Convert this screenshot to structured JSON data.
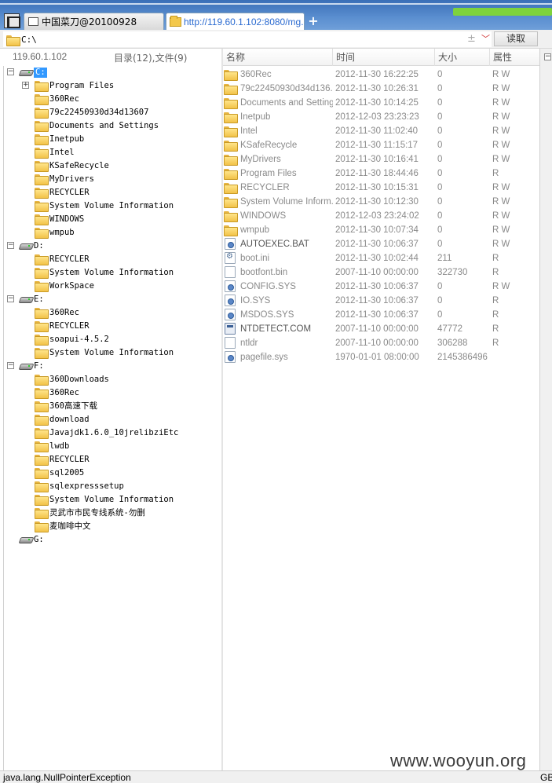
{
  "tabs": [
    {
      "label": "中国菜刀@20100928"
    },
    {
      "label": "http://119.60.1.102:8080/mg..."
    }
  ],
  "new_tab_label": "+",
  "address": {
    "path": "C:\\",
    "plus_label": "±",
    "read_button_label": "读取"
  },
  "left_header": {
    "host": "119.60.1.102",
    "summary": "目录(12),文件(9)"
  },
  "tree": [
    {
      "label": "C:",
      "type": "drive",
      "expander": "−",
      "selected": true
    },
    {
      "label": "Program Files",
      "type": "folder",
      "expander": "+"
    },
    {
      "label": "360Rec",
      "type": "folder"
    },
    {
      "label": "79c22450930d34d13607",
      "type": "folder"
    },
    {
      "label": "Documents and Settings",
      "type": "folder"
    },
    {
      "label": "Inetpub",
      "type": "folder"
    },
    {
      "label": "Intel",
      "type": "folder"
    },
    {
      "label": "KSafeRecycle",
      "type": "folder"
    },
    {
      "label": "MyDrivers",
      "type": "folder"
    },
    {
      "label": "RECYCLER",
      "type": "folder"
    },
    {
      "label": "System Volume Information",
      "type": "folder"
    },
    {
      "label": "WINDOWS",
      "type": "folder"
    },
    {
      "label": "wmpub",
      "type": "folder"
    },
    {
      "label": "D:",
      "type": "drive",
      "expander": "−"
    },
    {
      "label": "RECYCLER",
      "type": "folder"
    },
    {
      "label": "System Volume Information",
      "type": "folder"
    },
    {
      "label": "WorkSpace",
      "type": "folder"
    },
    {
      "label": "E:",
      "type": "drive",
      "expander": "−"
    },
    {
      "label": "360Rec",
      "type": "folder"
    },
    {
      "label": "RECYCLER",
      "type": "folder"
    },
    {
      "label": "soapui-4.5.2",
      "type": "folder"
    },
    {
      "label": "System Volume Information",
      "type": "folder"
    },
    {
      "label": "F:",
      "type": "drive",
      "expander": "−"
    },
    {
      "label": "360Downloads",
      "type": "folder"
    },
    {
      "label": "360Rec",
      "type": "folder"
    },
    {
      "label": "360高速下载",
      "type": "folder"
    },
    {
      "label": "download",
      "type": "folder"
    },
    {
      "label": "Javajdk1.6.0_10jrelibziEtc",
      "type": "folder"
    },
    {
      "label": "lwdb",
      "type": "folder"
    },
    {
      "label": "RECYCLER",
      "type": "folder"
    },
    {
      "label": "sql2005",
      "type": "folder"
    },
    {
      "label": "sqlexpresssetup",
      "type": "folder"
    },
    {
      "label": "System Volume Information",
      "type": "folder"
    },
    {
      "label": "灵武市市民专线系统-勿删",
      "type": "folder"
    },
    {
      "label": "麦咖啡中文",
      "type": "folder"
    },
    {
      "label": "G:",
      "type": "drive"
    }
  ],
  "columns": {
    "name": "名称",
    "time": "时间",
    "size": "大小",
    "attr": "属性"
  },
  "files": [
    {
      "name": "360Rec",
      "time": "2012-11-30 16:22:25",
      "size": "0",
      "attr": "R W",
      "icon": "folder"
    },
    {
      "name": "79c22450930d34d136...",
      "time": "2012-11-30 10:26:31",
      "size": "0",
      "attr": "R W",
      "icon": "folder"
    },
    {
      "name": "Documents and Settings",
      "time": "2012-11-30 10:14:25",
      "size": "0",
      "attr": "R W",
      "icon": "folder"
    },
    {
      "name": "Inetpub",
      "time": "2012-12-03 23:23:23",
      "size": "0",
      "attr": "R W",
      "icon": "folder"
    },
    {
      "name": "Intel",
      "time": "2012-11-30 11:02:40",
      "size": "0",
      "attr": "R W",
      "icon": "folder"
    },
    {
      "name": "KSafeRecycle",
      "time": "2012-11-30 11:15:17",
      "size": "0",
      "attr": "R W",
      "icon": "folder"
    },
    {
      "name": "MyDrivers",
      "time": "2012-11-30 10:16:41",
      "size": "0",
      "attr": "R W",
      "icon": "folder"
    },
    {
      "name": "Program Files",
      "time": "2012-11-30 18:44:46",
      "size": "0",
      "attr": "R",
      "icon": "folder"
    },
    {
      "name": "RECYCLER",
      "time": "2012-11-30 10:15:31",
      "size": "0",
      "attr": "R W",
      "icon": "folder"
    },
    {
      "name": "System Volume Inform...",
      "time": "2012-11-30 10:12:30",
      "size": "0",
      "attr": "R W",
      "icon": "folder"
    },
    {
      "name": "WINDOWS",
      "time": "2012-12-03 23:24:02",
      "size": "0",
      "attr": "R W",
      "icon": "folder"
    },
    {
      "name": "wmpub",
      "time": "2012-11-30 10:07:34",
      "size": "0",
      "attr": "R W",
      "icon": "folder"
    },
    {
      "name": "AUTOEXEC.BAT",
      "time": "2012-11-30 10:06:37",
      "size": "0",
      "attr": "R W",
      "icon": "sys",
      "dark": true
    },
    {
      "name": "boot.ini",
      "time": "2012-11-30 10:02:44",
      "size": "211",
      "attr": "R",
      "icon": "gear"
    },
    {
      "name": "bootfont.bin",
      "time": "2007-11-10 00:00:00",
      "size": "322730",
      "attr": "R",
      "icon": "file"
    },
    {
      "name": "CONFIG.SYS",
      "time": "2012-11-30 10:06:37",
      "size": "0",
      "attr": "R W",
      "icon": "sys"
    },
    {
      "name": "IO.SYS",
      "time": "2012-11-30 10:06:37",
      "size": "0",
      "attr": "R",
      "icon": "sys"
    },
    {
      "name": "MSDOS.SYS",
      "time": "2012-11-30 10:06:37",
      "size": "0",
      "attr": "R",
      "icon": "sys"
    },
    {
      "name": "NTDETECT.COM",
      "time": "2007-11-10 00:00:00",
      "size": "47772",
      "attr": "R",
      "icon": "exe",
      "dark": true
    },
    {
      "name": "ntldr",
      "time": "2007-11-10 00:00:00",
      "size": "306288",
      "attr": "R",
      "icon": "file"
    },
    {
      "name": "pagefile.sys",
      "time": "1970-01-01 08:00:00",
      "size": "2145386496",
      "attr": "",
      "icon": "sys"
    }
  ],
  "status": {
    "message": "java.lang.NullPointerException",
    "encoding": "GB"
  },
  "watermark": "www.wooyun.org"
}
